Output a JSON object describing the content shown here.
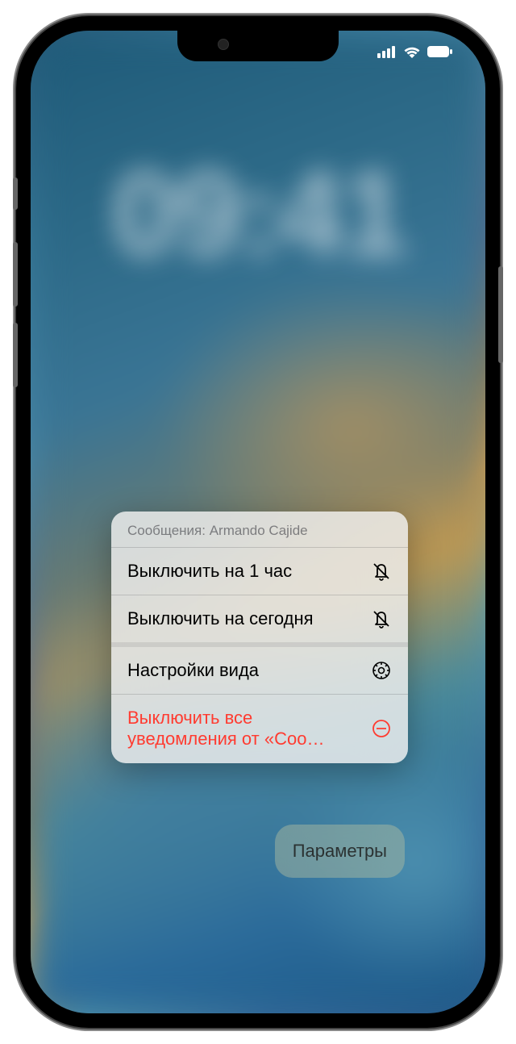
{
  "lock_screen": {
    "blurred_time": "09:41"
  },
  "context_menu": {
    "header": "Сообщения: Armando Cajide",
    "items": [
      {
        "label": "Выключить на 1 час",
        "icon": "bell-slash",
        "destructive": false
      },
      {
        "label": "Выключить на сегодня",
        "icon": "bell-slash",
        "destructive": false
      },
      {
        "label": "Настройки вида",
        "icon": "gear",
        "destructive": false
      },
      {
        "label": "Выключить все уведомления от «Соо…",
        "icon": "minus-circle",
        "destructive": true
      }
    ]
  },
  "options_button": {
    "label": "Параметры"
  }
}
